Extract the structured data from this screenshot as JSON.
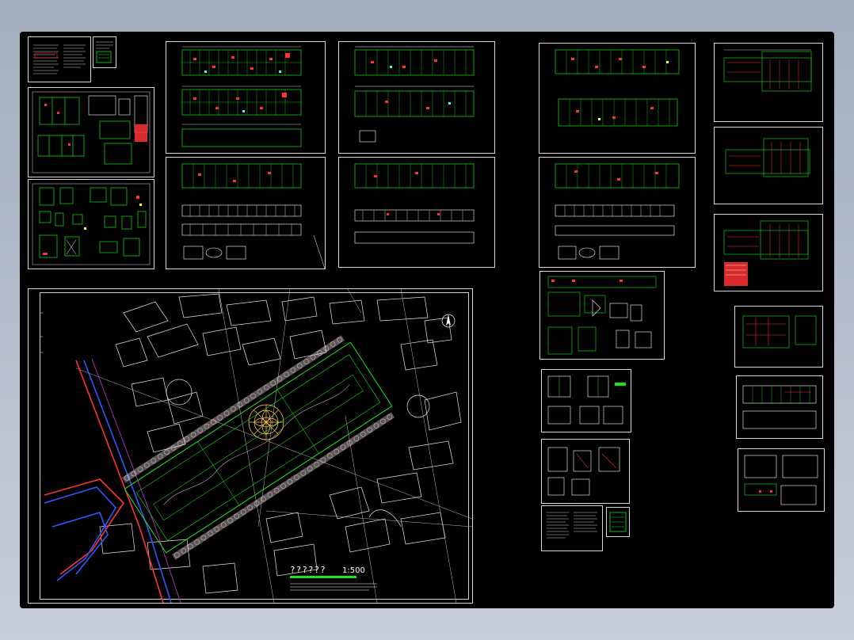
{
  "viewer": {
    "background_color": "#000000",
    "line_color": "#00ff00",
    "accent_color": "#ff3333",
    "white_line_color": "#ffffff"
  },
  "site_plan": {
    "title": "??????",
    "scale": "1:500"
  }
}
